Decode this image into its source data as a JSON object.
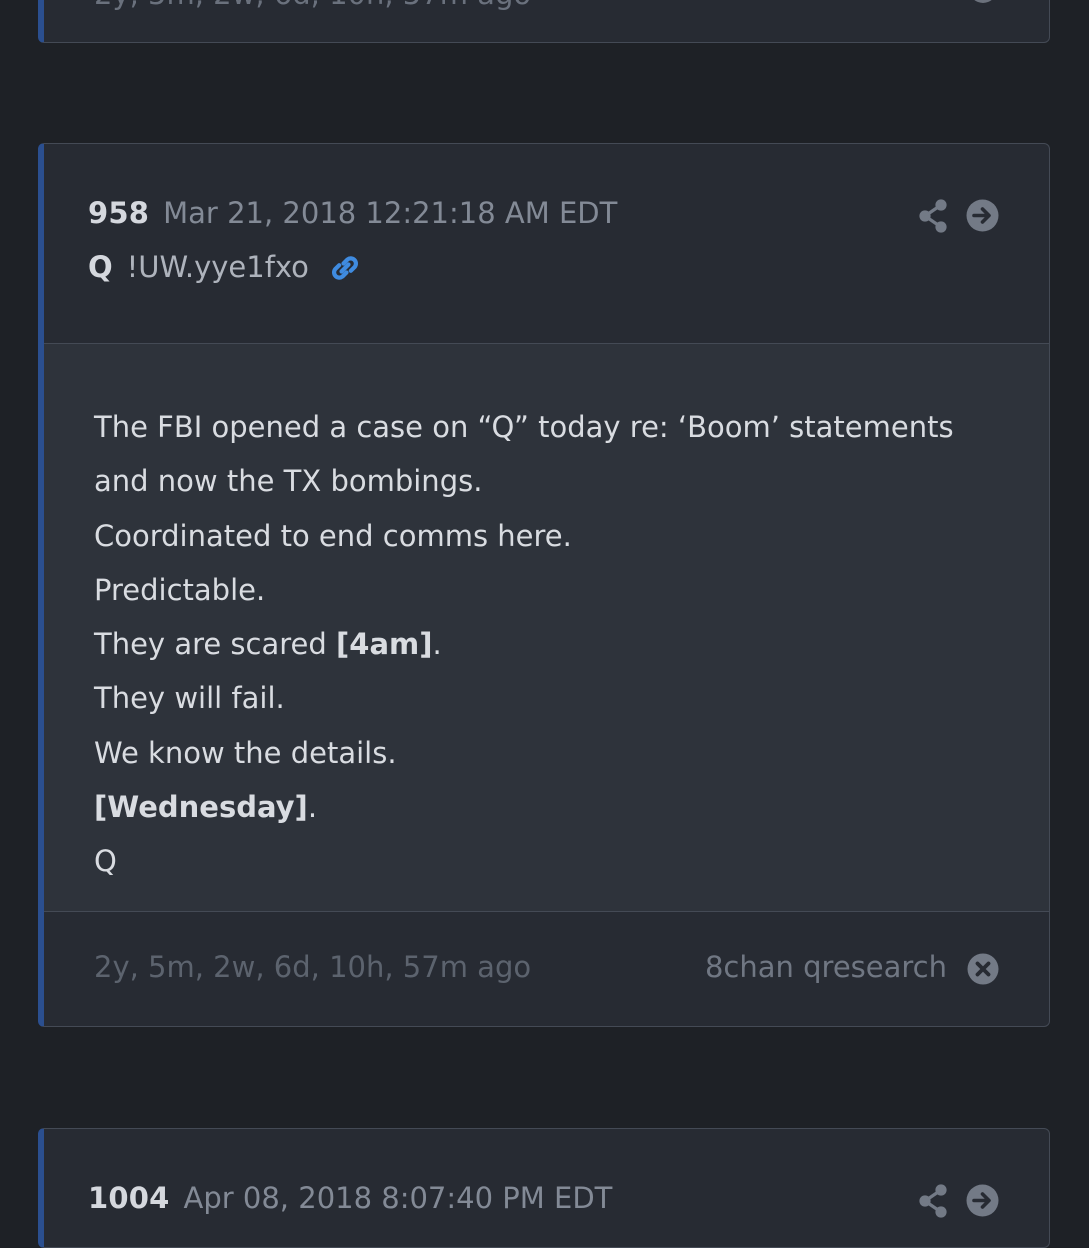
{
  "previous_post": {
    "partial_footer_text": "2y, 5m, 2w, 6d, 10h, 57m ago"
  },
  "post": {
    "number": "958",
    "date": "Mar 21, 2018 12:21:18 AM EDT",
    "author": "Q",
    "tripcode": "!UW.yye1fxo",
    "lines": [
      {
        "text": "The FBI opened a case on “Q” today re: ‘Boom’ statements"
      },
      {
        "text": "and now the TX bombings."
      },
      {
        "text": "Coordinated to end comms here."
      },
      {
        "text": "Predictable."
      },
      {
        "before": "They are scared ",
        "bold": "[4am]",
        "after": "."
      },
      {
        "text": "They will fail."
      },
      {
        "text": "We know the details."
      },
      {
        "before": "",
        "bold": "[Wednesday]",
        "after": "."
      },
      {
        "text": "Q"
      }
    ],
    "ago": "2y, 5m, 2w, 6d, 10h, 57m ago",
    "source": "8chan qresearch",
    "icons": {
      "share": "share-icon",
      "open": "arrow-right-circle-icon",
      "permalink": "link-icon",
      "close": "close-circle-icon"
    }
  },
  "next_post": {
    "number": "1004",
    "date": "Apr 08, 2018 8:07:40 PM EDT"
  },
  "colors": {
    "background": "#1e2126",
    "card": "#272b33",
    "card_body": "#2e333b",
    "accent_border": "#2b4f8f",
    "link": "#3f8be0"
  }
}
